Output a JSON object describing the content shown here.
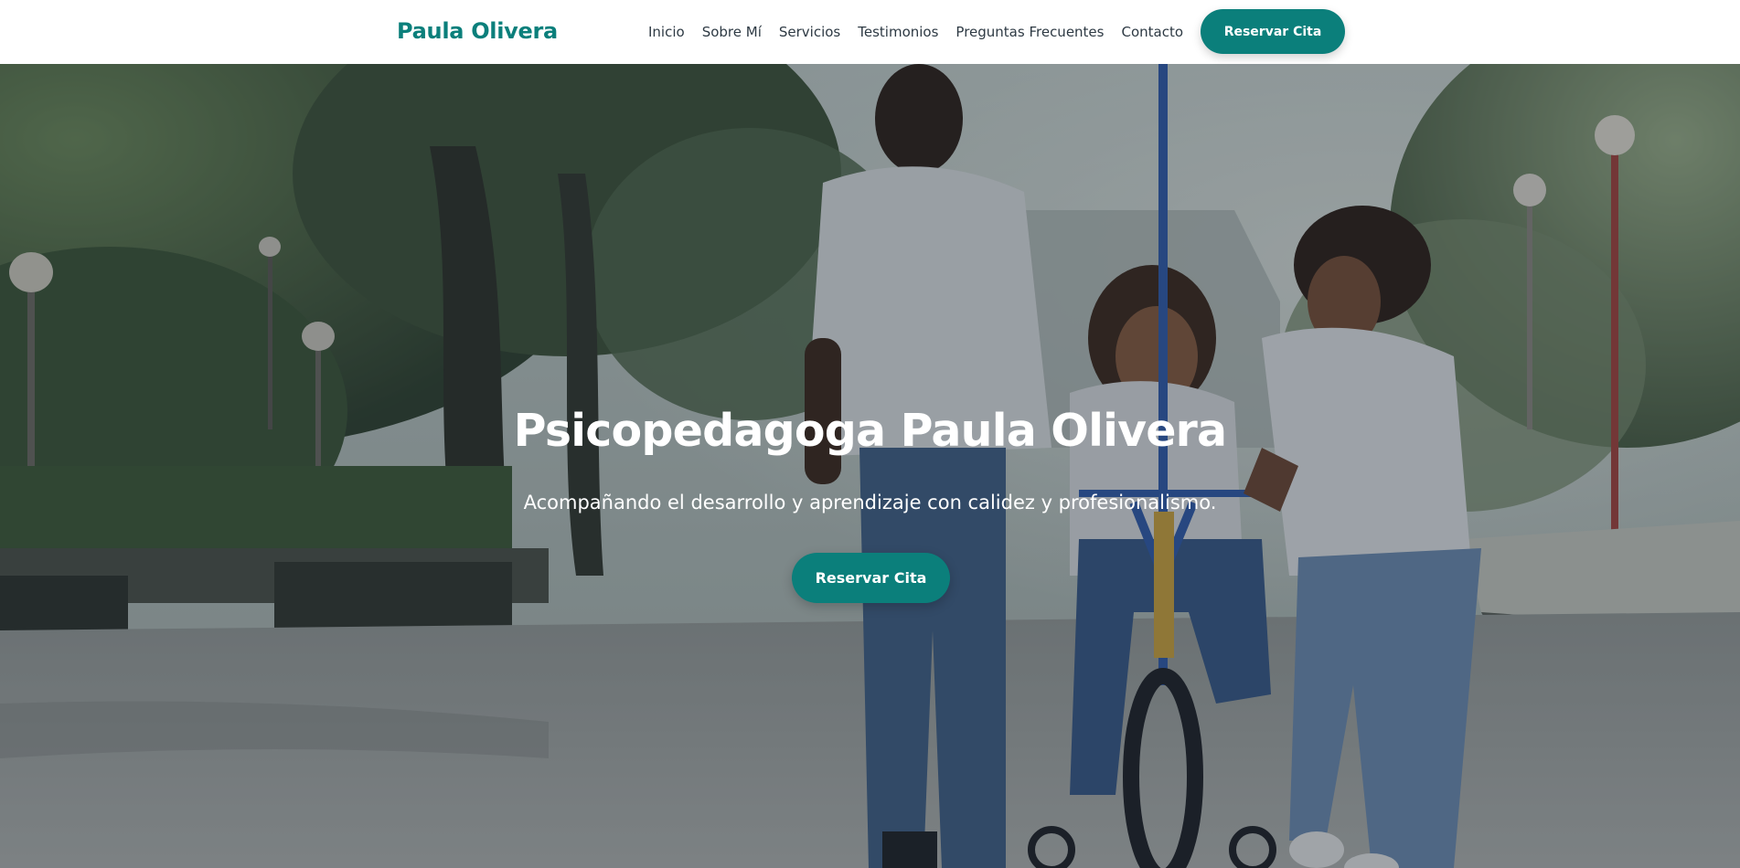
{
  "header": {
    "brand": "Paula Olivera",
    "nav": [
      {
        "label": "Inicio"
      },
      {
        "label": "Sobre Mí"
      },
      {
        "label": "Servicios"
      },
      {
        "label": "Testimonios"
      },
      {
        "label": "Preguntas Frecuentes"
      },
      {
        "label": "Contacto"
      }
    ],
    "cta_label": "Reservar Cita"
  },
  "hero": {
    "title": "Psicopedagoga Paula Olivera",
    "subtitle": "Acompañando el desarrollo y aprendizaje con calidez y profesionalismo.",
    "cta_label": "Reservar Cita",
    "background_image": "family-bicycle-park-photo"
  },
  "colors": {
    "accent": "#0b7f7b",
    "nav_text": "#2e3a44",
    "hero_text": "#ffffff"
  }
}
